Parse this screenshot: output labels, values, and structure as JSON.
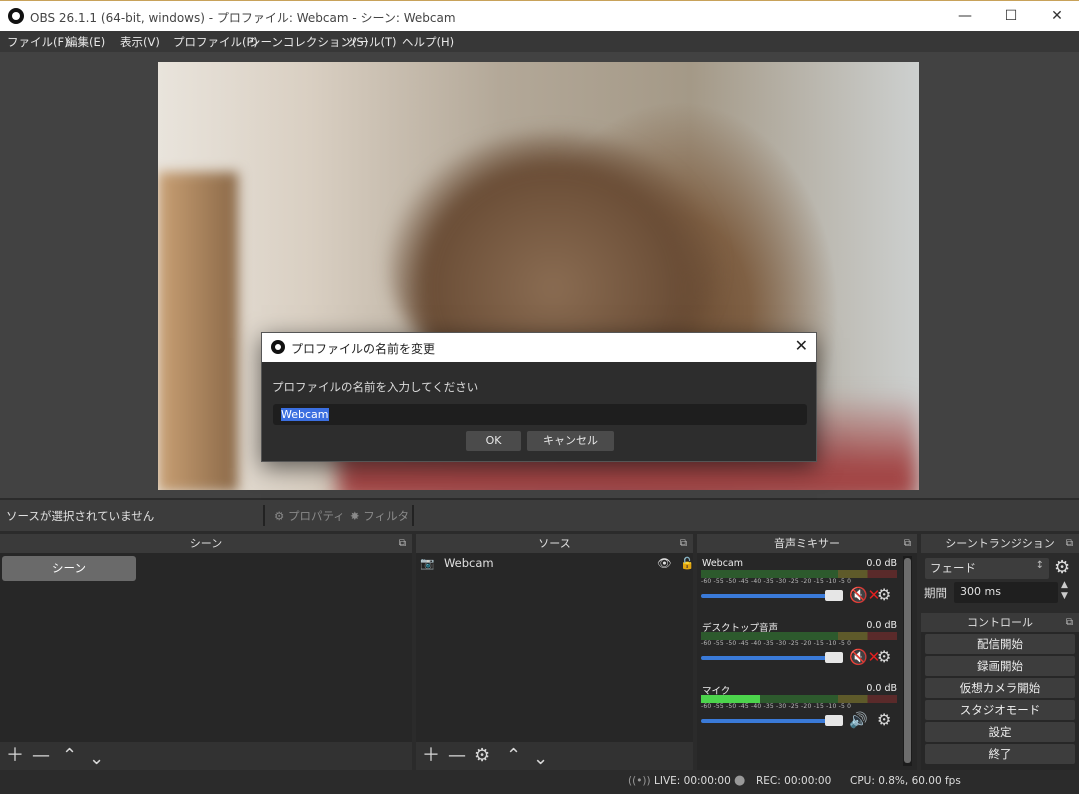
{
  "window": {
    "title": "OBS 26.1.1 (64-bit, windows) - プロファイル: Webcam - シーン: Webcam"
  },
  "menu": [
    "ファイル(F)",
    "編集(E)",
    "表示(V)",
    "プロファイル(P)",
    "シーンコレクション(S)",
    "ツール(T)",
    "ヘルプ(H)"
  ],
  "dialog": {
    "title": "プロファイルの名前を変更",
    "prompt": "プロファイルの名前を入力してください",
    "input_value": "Webcam",
    "ok_label": "OK",
    "cancel_label": "キャンセル"
  },
  "source_toolbar": {
    "no_selection": "ソースが選択されていません",
    "properties_label": "プロパティ",
    "filters_label": "フィルタ"
  },
  "scenes": {
    "header": "シーン",
    "items": [
      "シーン"
    ]
  },
  "sources": {
    "header": "ソース",
    "items": [
      "Webcam"
    ]
  },
  "mixer": {
    "header": "音声ミキサー",
    "scale": "-60 -55 -50 -45 -40 -35 -30 -25 -20 -15 -10 -5 0",
    "channels": [
      {
        "name": "Webcam",
        "db": "0.0 dB",
        "muted": true,
        "level": 0.0,
        "volume": 1.0
      },
      {
        "name": "デスクトップ音声",
        "db": "0.0 dB",
        "muted": true,
        "level": 0.0,
        "volume": 1.0
      },
      {
        "name": "マイク",
        "db": "0.0 dB",
        "muted": false,
        "level": 0.3,
        "volume": 1.0
      }
    ]
  },
  "transitions": {
    "header": "シーントランジション",
    "selected": "フェード",
    "duration_label": "期間",
    "duration_value": "300 ms"
  },
  "controls": {
    "header": "コントロール",
    "buttons": [
      "配信開始",
      "録画開始",
      "仮想カメラ開始",
      "スタジオモード",
      "設定",
      "終了"
    ]
  },
  "status": {
    "live": "LIVE: 00:00:00",
    "rec": "REC: 00:00:00",
    "cpu": "CPU: 0.8%, 60.00 fps"
  }
}
